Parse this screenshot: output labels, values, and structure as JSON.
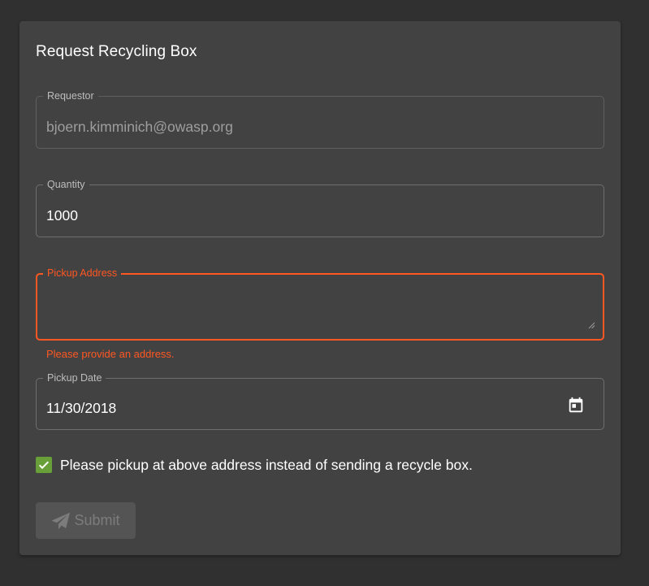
{
  "card": {
    "title": "Request Recycling Box"
  },
  "form": {
    "requestor": {
      "label": "Requestor",
      "value": "bjoern.kimminich@owasp.org"
    },
    "quantity": {
      "label": "Quantity",
      "value": "1000"
    },
    "pickup_address": {
      "label": "Pickup Address",
      "value": "",
      "error": "Please provide an address."
    },
    "pickup_date": {
      "label": "Pickup Date",
      "value": "11/30/2018",
      "icon": "calendar-icon"
    },
    "pickup_checkbox": {
      "checked": true,
      "label": "Please pickup at above address instead of sending a recycle box."
    },
    "submit": {
      "label": "Submit",
      "icon": "send-icon",
      "disabled": true
    }
  },
  "colors": {
    "background": "#303030",
    "card": "#424242",
    "error": "#ff5722",
    "checkbox": "#689f38"
  }
}
